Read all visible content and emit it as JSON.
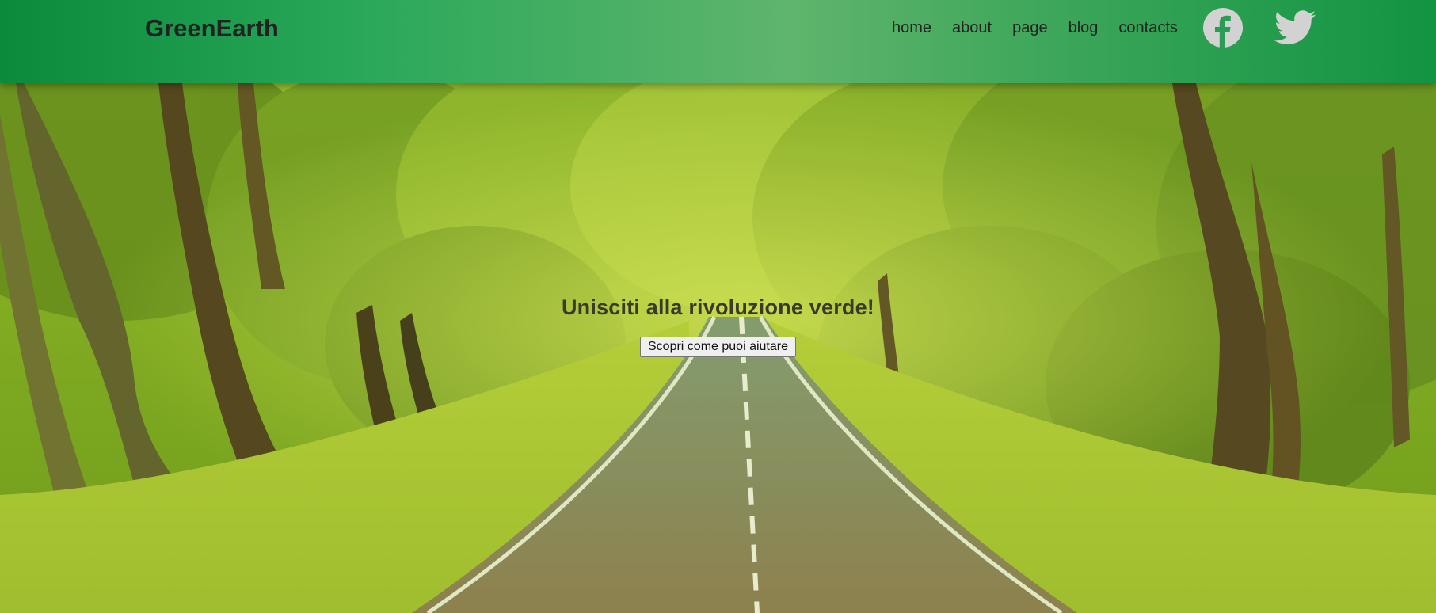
{
  "header": {
    "logo": "GreenEarth",
    "nav": [
      {
        "label": "home"
      },
      {
        "label": "about"
      },
      {
        "label": "page"
      },
      {
        "label": "blog"
      },
      {
        "label": "contacts"
      }
    ],
    "social": [
      {
        "icon": "facebook-icon"
      },
      {
        "icon": "twitter-icon"
      }
    ],
    "colors": {
      "header_green": "#2aa85a",
      "icon_gray": "#cfcfcf"
    }
  },
  "hero": {
    "background": "tree-lined road photo",
    "title": "Unisciti alla rivoluzione verde!",
    "button_label": "Scopri come puoi aiutare"
  }
}
